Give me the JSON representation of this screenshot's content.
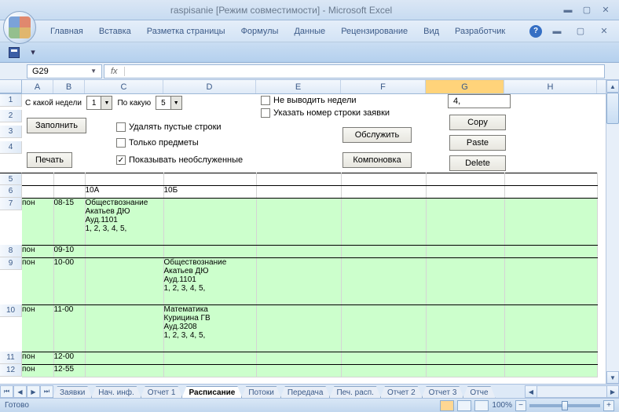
{
  "window": {
    "title": "raspisanie  [Режим совместимости] - Microsoft Excel"
  },
  "ribbon": {
    "tabs": [
      "Главная",
      "Вставка",
      "Разметка страницы",
      "Формулы",
      "Данные",
      "Рецензирование",
      "Вид",
      "Разработчик"
    ]
  },
  "namebox": "G29",
  "fx_label": "fx",
  "columns": [
    "A",
    "B",
    "C",
    "D",
    "E",
    "F",
    "G",
    "H"
  ],
  "selected_col": "G",
  "row_numbers": [
    "1",
    "2",
    "3",
    "4",
    "5",
    "6",
    "7",
    "8",
    "9",
    "10",
    "11",
    "12"
  ],
  "controls": {
    "week_from_label": "С какой недели",
    "week_from": "1",
    "week_to_label": "По какую",
    "week_to": "5",
    "fill_btn": "Заполнить",
    "print_btn": "Печать",
    "del_empty": "Удалять пустые строки",
    "only_subj": "Только предметы",
    "show_unserved": "Показывать необслуженные",
    "show_unserved_checked": "✓",
    "hide_weeks": "Не выводить недели",
    "show_req_row": "Указать номер строки заявки",
    "serve_btn": "Обслужить",
    "layout_btn": "Компоновка",
    "copy_btn": "Copy",
    "paste_btn": "Paste",
    "delete_btn": "Delete",
    "textbox": "4,"
  },
  "grid": {
    "r5_headers": {
      "C": "10А",
      "D": "10Б"
    },
    "rows": [
      {
        "A": "пон",
        "B": "08-15",
        "C": "Обществознание\nАкатьев ДЮ\nАуд.1101\n  1, 2, 3, 4, 5,",
        "D": ""
      },
      {
        "A": "пон",
        "B": "09-10",
        "C": "",
        "D": ""
      },
      {
        "A": "пон",
        "B": "10-00",
        "C": "",
        "D": "Обществознание\nАкатьев ДЮ\nАуд.1101\n  1, 2, 3, 4, 5,"
      },
      {
        "A": "пон",
        "B": "11-00",
        "C": "",
        "D": "Математика\nКурицина ГВ\nАуд.3208\n  1, 2, 3, 4, 5,"
      },
      {
        "A": "пон",
        "B": "12-00",
        "C": "",
        "D": ""
      },
      {
        "A": "пон",
        "B": "12-55",
        "C": "",
        "D": ""
      }
    ]
  },
  "sheet_tabs": [
    "Заявки",
    "Нач. инф.",
    "Отчет 1",
    "Расписание",
    "Потоки",
    "Передача",
    "Печ. расп.",
    "Отчет 2",
    "Отчет 3",
    "Отче"
  ],
  "active_tab": "Расписание",
  "status": "Готово",
  "zoom": "100%"
}
